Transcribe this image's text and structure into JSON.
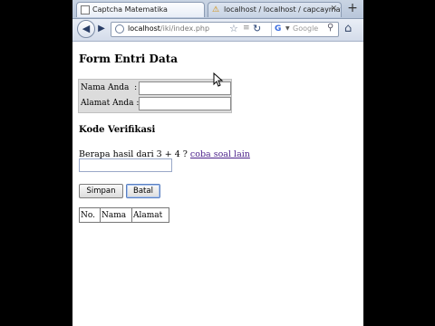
{
  "browser": {
    "tabs": [
      {
        "title": "Captcha Matematika",
        "active": true
      },
      {
        "title": "localhost / localhost / capcaymat ...",
        "active": false
      }
    ],
    "new_tab_label": "+",
    "url_host": "localhost",
    "url_path": "/iki/index.php",
    "search_placeholder": "Google"
  },
  "page": {
    "title": "Form Entri Data",
    "fields": [
      {
        "label": "Nama Anda",
        "sep": ":",
        "value": ""
      },
      {
        "label": "Alamat Anda",
        "sep": ":",
        "value": ""
      }
    ],
    "verification_heading": "Kode Verifikasi",
    "question": "Berapa hasil dari 3 + 4 ?",
    "other_question_link": "coba soal lain",
    "answer_value": "",
    "buttons": {
      "save": "Simpan",
      "cancel": "Batal"
    },
    "table_headers": [
      "No.",
      "Nama",
      "Alamat"
    ]
  },
  "colors": {
    "link": "#4a1f8a",
    "page_bg": "#ffffff",
    "frame_bg": "#000000"
  },
  "icons": [
    "page-favicon",
    "phpmyadmin-favicon",
    "close-icon",
    "back-icon",
    "forward-icon",
    "globe-icon",
    "bookmark-star-icon",
    "rss-icon",
    "reload-icon",
    "google-icon",
    "search-icon",
    "home-icon",
    "mouse-pointer-icon"
  ]
}
